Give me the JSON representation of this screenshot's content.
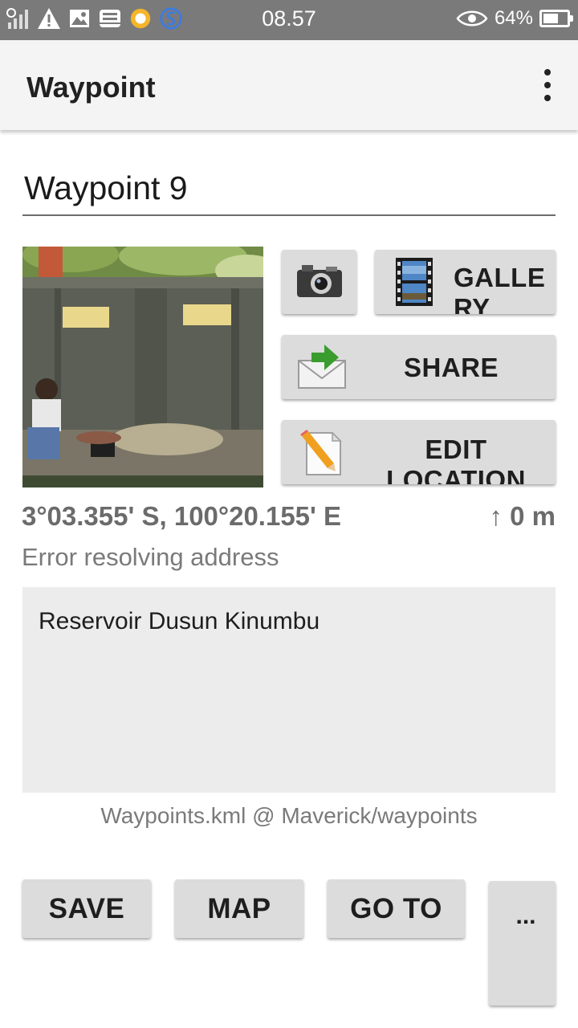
{
  "status_bar": {
    "time": "08.57",
    "battery_percent": "64%",
    "battery_level": 0.64,
    "icons": [
      "signal-icon",
      "warning-icon",
      "image-icon",
      "tray-icon",
      "brightness-icon",
      "sync-icon",
      "eye-icon",
      "battery-icon"
    ]
  },
  "app_bar": {
    "title": "Waypoint",
    "menu_icon": "overflow-menu-icon"
  },
  "waypoint": {
    "name": "Waypoint 9",
    "coordinates": "3°03.355' S, 100°20.155' E",
    "altitude": "↑ 0 m",
    "address": "Error resolving address",
    "notes": "Reservoir Dusun Kinumbu",
    "file_info": "Waypoints.kml @ Maverick/waypoints"
  },
  "actions": {
    "camera_icon": "camera-icon",
    "gallery_label": "GALLE\nRY",
    "gallery_icon": "film-strip-icon",
    "share_label": "SHARE",
    "share_icon": "envelope-icon",
    "edit_label": "EDIT\nLOCATION",
    "edit_icon": "pencil-icon"
  },
  "bottom_bar": {
    "save_label": "SAVE",
    "map_label": "MAP",
    "goto_label": "GO TO",
    "more_label": ". . ."
  },
  "colors": {
    "status_bar": "#7a7a7a",
    "app_bar": "#f4f4f4",
    "button": "#dcdcdc",
    "notes_bg": "#ececec",
    "secondary_text": "#7a7a7a"
  }
}
